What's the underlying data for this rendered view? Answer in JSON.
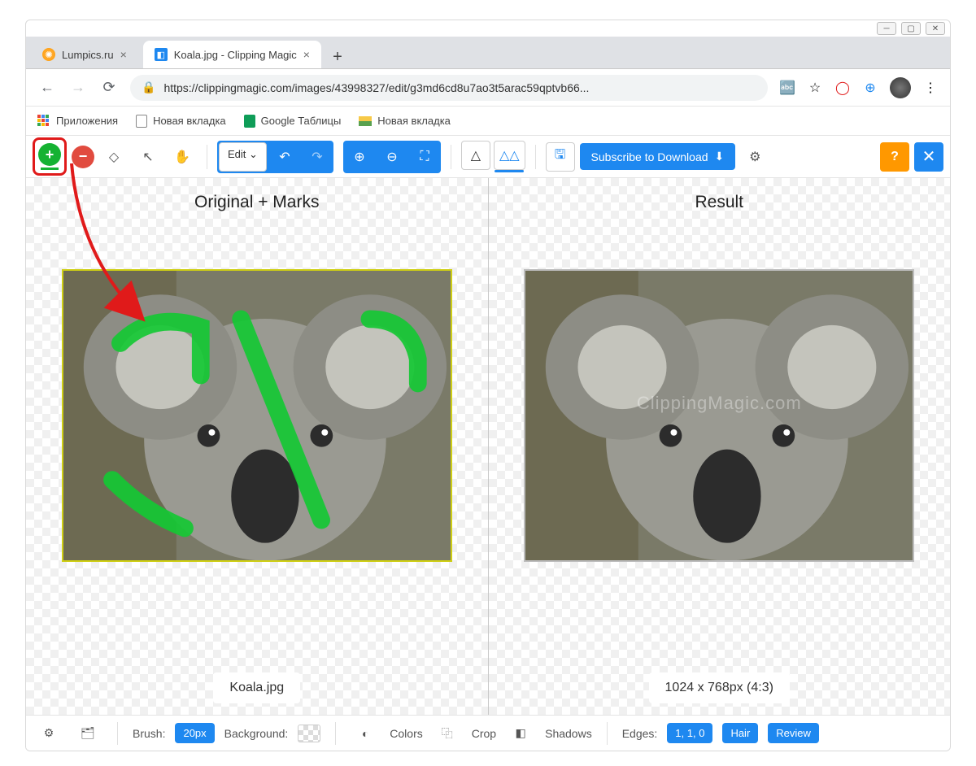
{
  "browser": {
    "tabs": [
      {
        "title": "Lumpics.ru",
        "active": false
      },
      {
        "title": "Koala.jpg - Clipping Magic",
        "active": true
      }
    ],
    "url": "https://clippingmagic.com/images/43998327/edit/g3md6cd8u7ao3t5arac59qptvb66...",
    "bookmarks": {
      "apps": "Приложения",
      "bm1": "Новая вкладка",
      "bm2": "Google Таблицы",
      "bm3": "Новая вкладка"
    }
  },
  "toolbar": {
    "edit_label": "Edit",
    "subscribe": "Subscribe to Download",
    "help": "?"
  },
  "workspace": {
    "left_title": "Original + Marks",
    "right_title": "Result",
    "filename": "Koala.jpg",
    "dimensions": "1024 x 768px (4:3)",
    "watermark": "ClippingMagic.com"
  },
  "bottombar": {
    "brush_label": "Brush:",
    "brush_value": "20px",
    "background_label": "Background:",
    "colors": "Colors",
    "crop": "Crop",
    "shadows": "Shadows",
    "edges_label": "Edges:",
    "edges_value": "1, 1, 0",
    "hair": "Hair",
    "review": "Review"
  }
}
